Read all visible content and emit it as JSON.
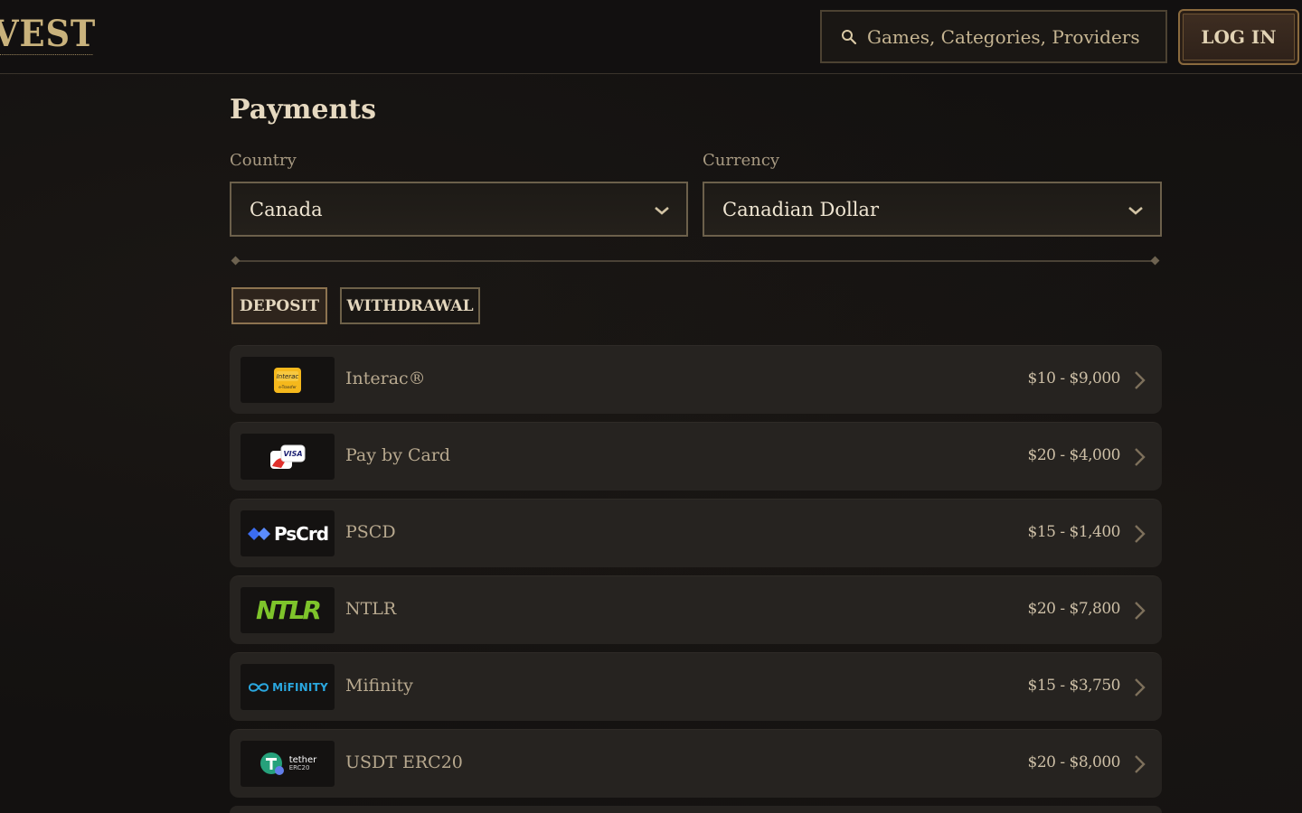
{
  "header": {
    "logo_text": "VEST",
    "search_placeholder": "Games, Categories, Providers",
    "login_label": "LOG IN"
  },
  "main": {
    "title": "Payments",
    "country": {
      "label": "Country",
      "value": "Canada"
    },
    "currency": {
      "label": "Currency",
      "value": "Canadian Dollar"
    },
    "tabs": [
      {
        "label": "DEPOSIT",
        "active": true
      },
      {
        "label": "WITHDRAWAL",
        "active": false
      }
    ],
    "methods": [
      {
        "name": "Interac®",
        "range": "$10 - $9,000",
        "icon": "interac-logo"
      },
      {
        "name": "Pay by Card",
        "range": "$20 - $4,000",
        "icon": "visa-card-logo"
      },
      {
        "name": "PSCD",
        "range": "$15 - $1,400",
        "icon": "pscrd-logo",
        "logo_text": "PsCrd"
      },
      {
        "name": "NTLR",
        "range": "$20 - $7,800",
        "icon": "ntlr-logo",
        "logo_text": "NTLR"
      },
      {
        "name": "Mifinity",
        "range": "$15 - $3,750",
        "icon": "mifinity-logo",
        "logo_text": "MiFINITY"
      },
      {
        "name": "USDT ERC20",
        "range": "$20 - $8,000",
        "icon": "tether-logo",
        "logo_text": "tether",
        "logo_subtext": "ERC20"
      }
    ]
  },
  "colors": {
    "background": "#131110",
    "card": "#262320",
    "accent_gold": "#c9b27c",
    "ntlr_green": "#7ec42b",
    "mifinity_blue": "#2aa8e0",
    "tether_teal": "#26a17b",
    "interac_yellow": "#f5b81c"
  }
}
